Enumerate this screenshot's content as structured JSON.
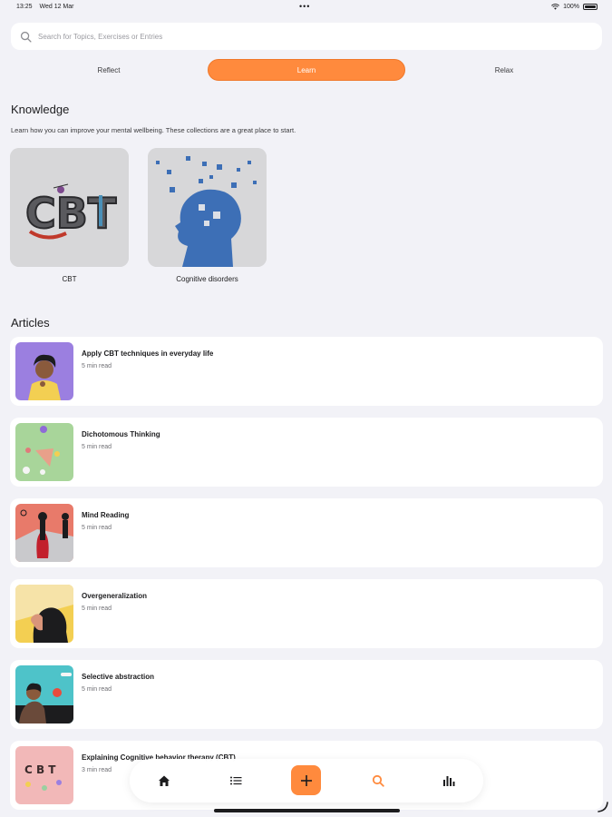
{
  "status_bar": {
    "time": "13:25",
    "date": "Wed 12 Mar",
    "dots": "•••",
    "battery": "100%"
  },
  "search": {
    "placeholder": "Search for Topics, Exercises or Entries"
  },
  "segments": {
    "reflect": "Reflect",
    "learn": "Learn",
    "relax": "Relax",
    "selected": "learn"
  },
  "knowledge": {
    "title": "Knowledge",
    "description": "Learn how you can improve your mental wellbeing. These collections are a great place to start.",
    "collections": [
      {
        "label": "CBT"
      },
      {
        "label": "Cognitive disorders"
      }
    ]
  },
  "cbt_logo_text": "CBT",
  "articles": {
    "title": "Articles",
    "items": [
      {
        "title": "Apply CBT techniques in everyday life",
        "meta": "5 min read"
      },
      {
        "title": "Dichotomous Thinking",
        "meta": "5 min read"
      },
      {
        "title": "Mind Reading",
        "meta": "5 min read"
      },
      {
        "title": "Overgeneralization",
        "meta": "5 min read"
      },
      {
        "title": "Selective abstraction",
        "meta": "5 min read"
      },
      {
        "title": "Explaining Cognitive behavior therapy (CBT)",
        "meta": "3 min read"
      }
    ]
  },
  "article_thumb_text": "C B T",
  "tabbar": {
    "icons": [
      "home-icon",
      "list-icon",
      "plus-icon",
      "search-icon",
      "bar-chart-icon"
    ],
    "active": "search-icon"
  },
  "colors": {
    "accent": "#ff8a3d",
    "background": "#f2f2f7",
    "card": "#ffffff"
  }
}
